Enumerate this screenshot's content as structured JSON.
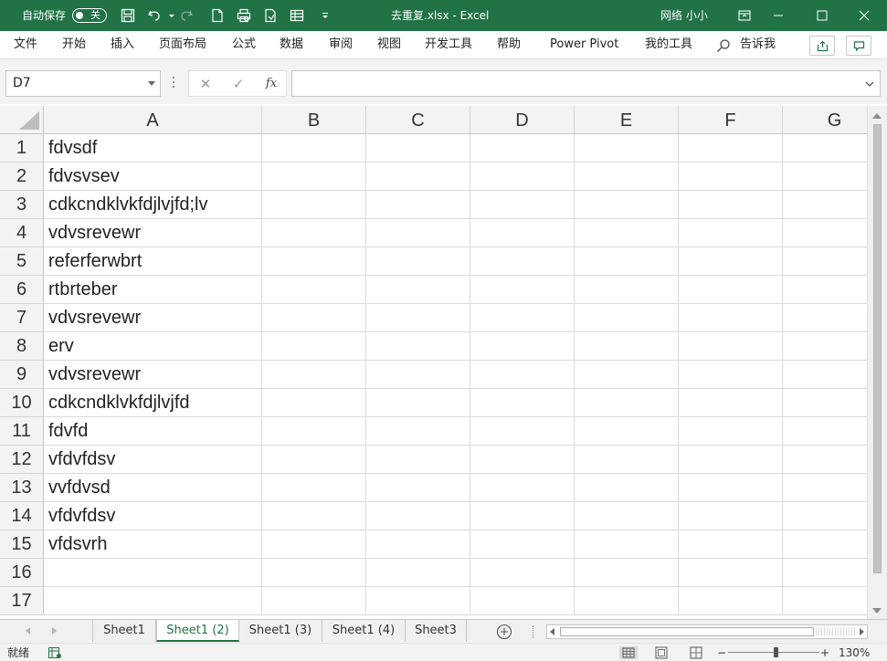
{
  "titlebar": {
    "autosave_label": "自动保存",
    "autosave_state": "关",
    "file_title": "去重复.xlsx  -  Excel",
    "user_name": "网络 小小"
  },
  "ribbon": {
    "tabs": [
      "文件",
      "开始",
      "插入",
      "页面布局",
      "公式",
      "数据",
      "审阅",
      "视图",
      "开发工具",
      "帮助",
      "Power Pivot",
      "我的工具"
    ],
    "tell_me": "告诉我"
  },
  "formula_bar": {
    "name_box": "D7",
    "fx_label": "fx",
    "formula": ""
  },
  "grid": {
    "columns": [
      "A",
      "B",
      "C",
      "D",
      "E",
      "F",
      "G"
    ],
    "rows": [
      {
        "num": "1",
        "a": "fdvsdf"
      },
      {
        "num": "2",
        "a": "fdvsvsev"
      },
      {
        "num": "3",
        "a": "cdkcndklvkfdjlvjfd;lv"
      },
      {
        "num": "4",
        "a": "vdvsrevewr"
      },
      {
        "num": "5",
        "a": "referferwbrt"
      },
      {
        "num": "6",
        "a": "rtbrteber"
      },
      {
        "num": "7",
        "a": "vdvsrevewr"
      },
      {
        "num": "8",
        "a": "erv"
      },
      {
        "num": "9",
        "a": "vdvsrevewr"
      },
      {
        "num": "10",
        "a": "cdkcndklvkfdjlvjfd"
      },
      {
        "num": "11",
        "a": "fdvfd"
      },
      {
        "num": "12",
        "a": "vfdvfdsv"
      },
      {
        "num": "13",
        "a": "vvfdvsd"
      },
      {
        "num": "14",
        "a": "vfdvfdsv"
      },
      {
        "num": "15",
        "a": "vfdsvrh"
      },
      {
        "num": "16",
        "a": ""
      },
      {
        "num": "17",
        "a": ""
      }
    ]
  },
  "sheets": {
    "tabs": [
      "Sheet1",
      "Sheet1 (2)",
      "Sheet1 (3)",
      "Sheet1 (4)",
      "Sheet3"
    ],
    "active": "Sheet1 (2)"
  },
  "statusbar": {
    "mode": "就绪",
    "zoom_minus": "−",
    "zoom_plus": "+",
    "zoom": "130%"
  },
  "colors": {
    "excel_green": "#217346",
    "header_bg": "#f3f3f3",
    "gridline": "#dadada"
  }
}
